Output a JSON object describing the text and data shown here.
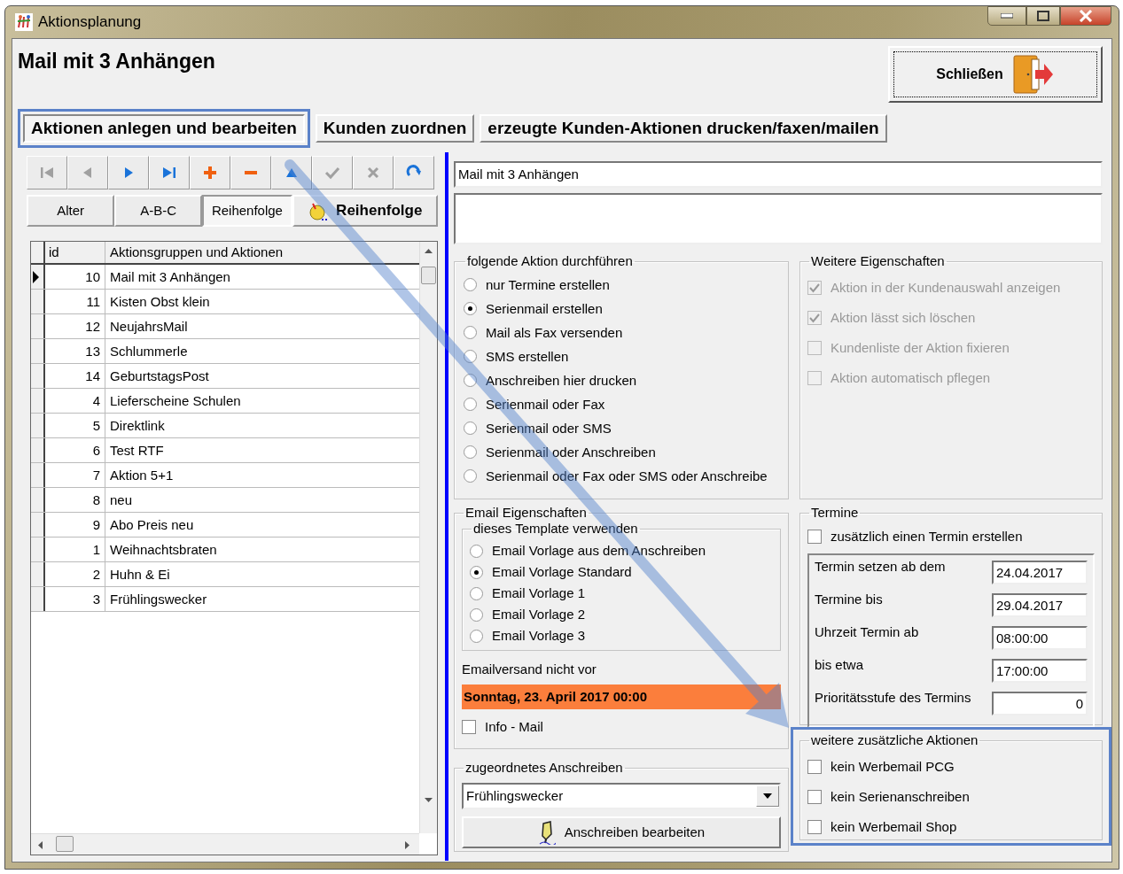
{
  "window": {
    "title": "Aktionsplanung"
  },
  "header": {
    "title": "Mail mit 3 Anhängen",
    "close_button": "Schließen"
  },
  "tabs": [
    {
      "label": "Aktionen anlegen und bearbeiten",
      "selected": true,
      "highlighted": true
    },
    {
      "label": "Kunden zuordnen",
      "selected": false,
      "highlighted": false
    },
    {
      "label": "erzeugte Kunden-Aktionen drucken/faxen/mailen",
      "selected": false,
      "highlighted": false
    }
  ],
  "toolbar": [
    {
      "kind": "first",
      "disabled": true
    },
    {
      "kind": "prev",
      "disabled": true
    },
    {
      "kind": "next",
      "disabled": false
    },
    {
      "kind": "last",
      "disabled": false
    },
    {
      "kind": "add",
      "disabled": false
    },
    {
      "kind": "remove",
      "disabled": false
    },
    {
      "kind": "edit",
      "disabled": false
    },
    {
      "kind": "post",
      "disabled": true
    },
    {
      "kind": "cancel",
      "disabled": true
    },
    {
      "kind": "refresh",
      "disabled": false
    }
  ],
  "sort_buttons": [
    {
      "label": "Alter",
      "selected": false,
      "kind": "plain"
    },
    {
      "label": "A-B-C",
      "selected": false,
      "kind": "plain"
    },
    {
      "label": "Reihenfolge",
      "selected": true,
      "kind": "plain"
    },
    {
      "label": "Reihenfolge",
      "selected": false,
      "kind": "icon"
    }
  ],
  "grid": {
    "columns": [
      "id",
      "Aktionsgruppen und Aktionen"
    ],
    "rows": [
      {
        "id": "10",
        "name": "Mail mit 3 Anhängen",
        "selected": true
      },
      {
        "id": "11",
        "name": "Kisten Obst klein",
        "selected": false
      },
      {
        "id": "12",
        "name": "NeujahrsMail",
        "selected": false
      },
      {
        "id": "13",
        "name": "Schlummerle",
        "selected": false
      },
      {
        "id": "14",
        "name": "GeburtstagsPost",
        "selected": false
      },
      {
        "id": "4",
        "name": "Lieferscheine Schulen",
        "selected": false
      },
      {
        "id": "5",
        "name": "Direktlink",
        "selected": false
      },
      {
        "id": "6",
        "name": "Test RTF",
        "selected": false
      },
      {
        "id": "7",
        "name": "Aktion 5+1",
        "selected": false
      },
      {
        "id": "8",
        "name": "neu",
        "selected": false
      },
      {
        "id": "9",
        "name": "Abo  Preis neu",
        "selected": false
      },
      {
        "id": "1",
        "name": "Weihnachtsbraten",
        "selected": false
      },
      {
        "id": "2",
        "name": "Huhn & Ei",
        "selected": false
      },
      {
        "id": "3",
        "name": "Frühlingswecker",
        "selected": false
      }
    ]
  },
  "name_field": {
    "value": "Mail mit 3 Anhängen"
  },
  "action_group": {
    "title": "folgende Aktion durchführen",
    "options": [
      {
        "label": "nur Termine erstellen",
        "selected": false
      },
      {
        "label": "Serienmail erstellen",
        "selected": true
      },
      {
        "label": "Mail als Fax versenden",
        "selected": false
      },
      {
        "label": "SMS erstellen",
        "selected": false
      },
      {
        "label": "Anschreiben hier drucken",
        "selected": false
      },
      {
        "label": "Serienmail oder Fax",
        "selected": false
      },
      {
        "label": "Serienmail oder SMS",
        "selected": false
      },
      {
        "label": "Serienmail oder Anschreiben",
        "selected": false
      },
      {
        "label": "Serienmail oder Fax oder SMS oder Anschreibe",
        "selected": false
      }
    ]
  },
  "properties": {
    "title": "Weitere Eigenschaften",
    "options": [
      {
        "label": "Aktion in der Kundenauswahl anzeigen",
        "checked": true,
        "disabled": true
      },
      {
        "label": "Aktion lässt sich löschen",
        "checked": true,
        "disabled": true
      },
      {
        "label": "Kundenliste der Aktion fixieren",
        "checked": false,
        "disabled": true
      },
      {
        "label": "Aktion automatisch pflegen",
        "checked": false,
        "disabled": true
      }
    ]
  },
  "email": {
    "title": "Email Eigenschaften",
    "template": {
      "title": "dieses Template verwenden",
      "options": [
        {
          "label": "Email Vorlage aus dem Anschreiben",
          "selected": false
        },
        {
          "label": "Email Vorlage Standard",
          "selected": true
        },
        {
          "label": "Email Vorlage 1",
          "selected": false
        },
        {
          "label": "Email Vorlage 2",
          "selected": false
        },
        {
          "label": "Email Vorlage 3",
          "selected": false
        }
      ]
    },
    "send_label": "Emailversand nicht vor",
    "send_date": "Sonntag, 23. April 2017 00:00",
    "info_mail": {
      "label": "Info - Mail",
      "checked": false
    }
  },
  "appointments": {
    "title": "Termine",
    "create": {
      "label": "zusätzlich einen Termin erstellen",
      "checked": false
    },
    "fields": [
      {
        "label": "Termin setzen ab dem",
        "value": "24.04.2017",
        "kind": "text"
      },
      {
        "label": "Termine bis",
        "value": "29.04.2017",
        "kind": "text"
      },
      {
        "label": "Uhrzeit Termin ab",
        "value": "08:00:00",
        "kind": "text"
      },
      {
        "label": "bis etwa",
        "value": "17:00:00",
        "kind": "text"
      },
      {
        "label": "Prioritätsstufe des Termins",
        "value": "0",
        "kind": "number"
      }
    ]
  },
  "letter": {
    "title": "zugeordnetes Anschreiben",
    "value": "Frühlingswecker",
    "button": "Anschreiben bearbeiten"
  },
  "extra": {
    "title": "weitere zusätzliche Aktionen",
    "highlighted": true,
    "options": [
      {
        "label": "kein Werbemail PCG",
        "checked": false
      },
      {
        "label": "kein Serienanschreiben",
        "checked": false
      },
      {
        "label": "kein Werbemail Shop",
        "checked": false
      }
    ]
  }
}
